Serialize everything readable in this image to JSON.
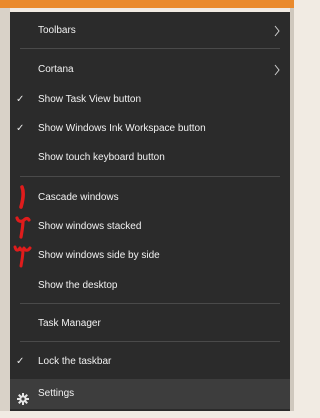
{
  "menu": {
    "toolbars": "Toolbars",
    "cortana": "Cortana",
    "show_task_view": "Show Task View button",
    "show_ink_workspace": "Show Windows Ink Workspace button",
    "show_touch_keyboard": "Show touch keyboard button",
    "cascade": "Cascade windows",
    "stacked": "Show windows stacked",
    "side_by_side": "Show windows side by side",
    "show_desktop": "Show the desktop",
    "task_manager": "Task Manager",
    "lock_taskbar": "Lock the taskbar",
    "settings": "Settings",
    "check_glyph": "✓",
    "markers": [
      "۱",
      "۲",
      "۳"
    ]
  },
  "colors": {
    "menu_bg": "#2b2b2b",
    "accent": "#ea8a2c",
    "marker_red": "#e01c1c"
  },
  "icons": [
    "chevron-right-icon",
    "check-icon",
    "gear-icon"
  ]
}
